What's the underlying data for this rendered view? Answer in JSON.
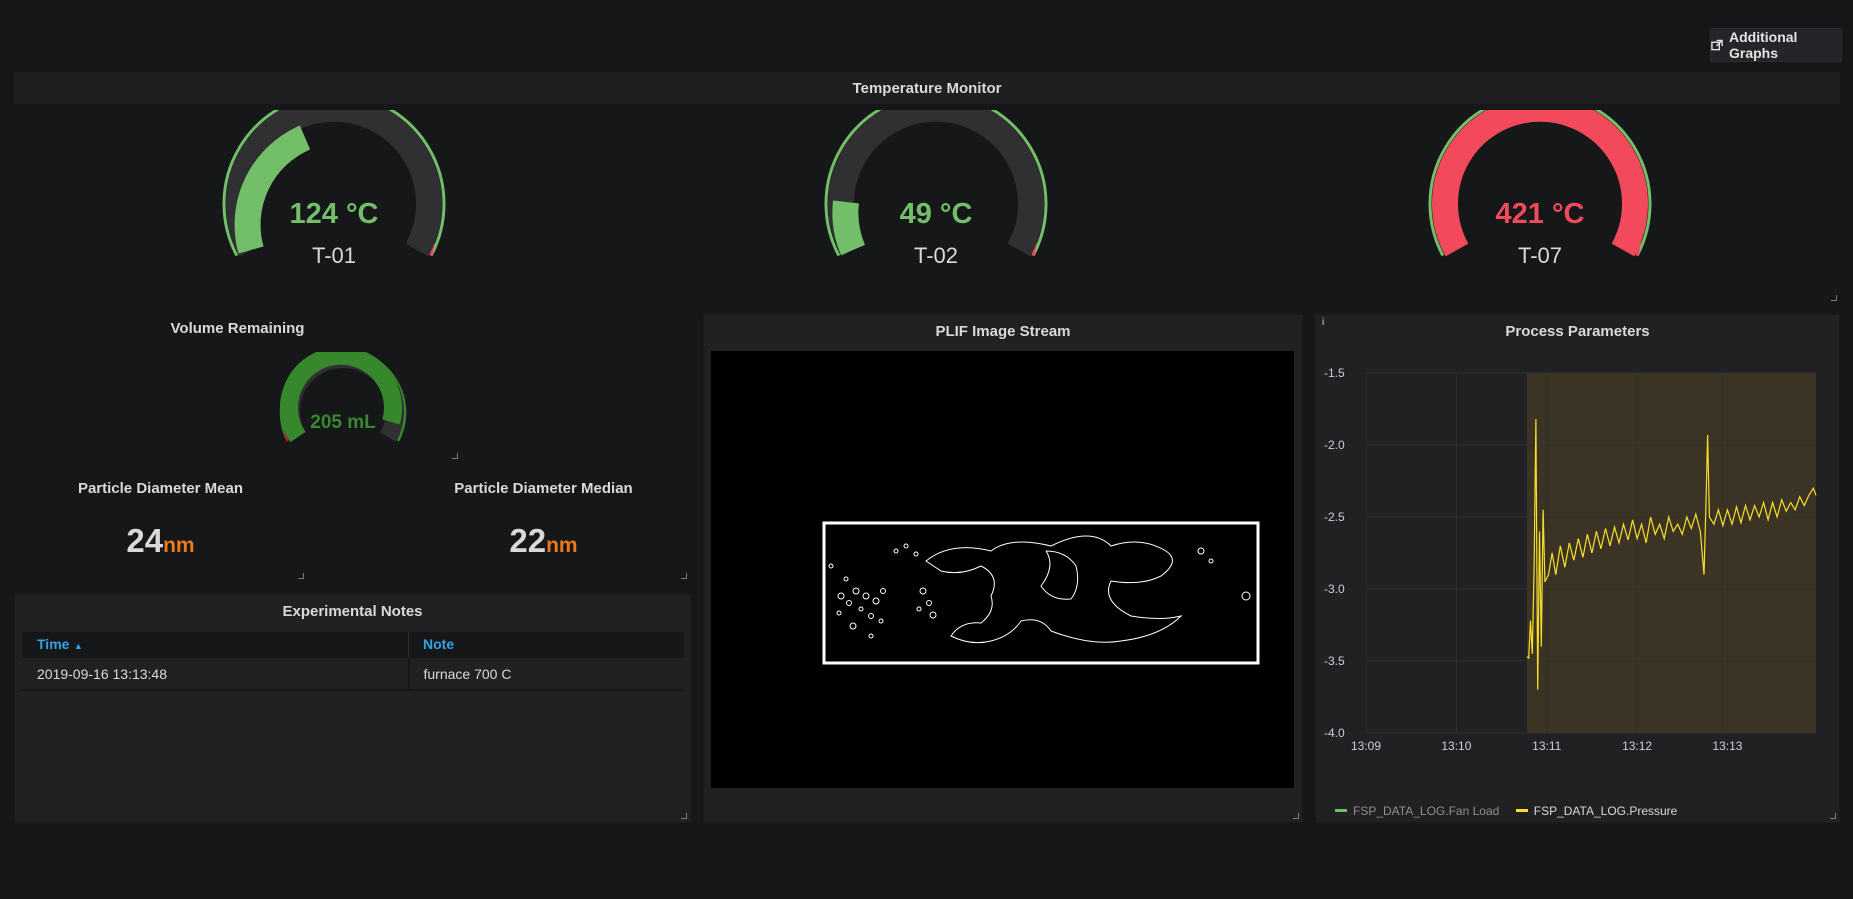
{
  "toolbar": {
    "additional_graphs_label": "Additional Graphs"
  },
  "temperature_monitor": {
    "title": "Temperature Monitor",
    "gauges": [
      {
        "name": "T-01",
        "value_text": "124 °C",
        "value": 124,
        "status_color": "#73bf69"
      },
      {
        "name": "T-02",
        "value_text": "49 °C",
        "value": 49,
        "status_color": "#73bf69"
      },
      {
        "name": "T-07",
        "value_text": "421 °C",
        "value": 421,
        "status_color": "#f2495c"
      }
    ]
  },
  "volume": {
    "title": "Volume Remaining",
    "value_text": "205 mL",
    "value": 205,
    "status_color": "#37872d"
  },
  "particle_mean": {
    "title": "Particle Diameter Mean",
    "value": "24",
    "unit": "nm"
  },
  "particle_median": {
    "title": "Particle Diameter Median",
    "value": "22",
    "unit": "nm"
  },
  "notes": {
    "title": "Experimental Notes",
    "columns": [
      "Time",
      "Note"
    ],
    "sort_indicator": "▲",
    "rows": [
      [
        "2019-09-16 13:13:48",
        "furnace 700 C"
      ]
    ]
  },
  "plif": {
    "title": "PLIF Image Stream"
  },
  "process": {
    "title": "Process Parameters",
    "info_icon": "i",
    "legend": [
      {
        "name": "FSP_DATA_LOG.Fan Load",
        "color": "#73bf69"
      },
      {
        "name": "FSP_DATA_LOG.Pressure",
        "color": "#fade2a"
      }
    ]
  },
  "chart_data": {
    "type": "line",
    "title": "Process Parameters",
    "x_ticks": [
      "13:09",
      "13:10",
      "13:11",
      "13:12",
      "13:13"
    ],
    "y_ticks": [
      "-1.5",
      "-2.0",
      "-2.5",
      "-3.0",
      "-3.5",
      "-4.0"
    ],
    "ylim": [
      -4.0,
      -1.5
    ],
    "xlim_minutes": [
      9.0,
      13.98
    ],
    "shaded_region_minutes": [
      10.78,
      13.98
    ],
    "series": [
      {
        "name": "FSP_DATA_LOG.Pressure",
        "color": "#fade2a",
        "points_minutes": [
          [
            10.78,
            -3.47
          ],
          [
            10.8,
            -3.48
          ],
          [
            10.82,
            -3.22
          ],
          [
            10.84,
            -3.45
          ],
          [
            10.86,
            -2.85
          ],
          [
            10.88,
            -1.82
          ],
          [
            10.9,
            -3.7
          ],
          [
            10.92,
            -2.6
          ],
          [
            10.94,
            -3.4
          ],
          [
            10.96,
            -2.45
          ],
          [
            10.98,
            -2.95
          ],
          [
            11.02,
            -2.9
          ],
          [
            11.06,
            -2.75
          ],
          [
            11.1,
            -2.9
          ],
          [
            11.15,
            -2.7
          ],
          [
            11.2,
            -2.85
          ],
          [
            11.25,
            -2.68
          ],
          [
            11.3,
            -2.8
          ],
          [
            11.35,
            -2.65
          ],
          [
            11.4,
            -2.78
          ],
          [
            11.45,
            -2.62
          ],
          [
            11.5,
            -2.75
          ],
          [
            11.55,
            -2.6
          ],
          [
            11.6,
            -2.72
          ],
          [
            11.65,
            -2.58
          ],
          [
            11.7,
            -2.7
          ],
          [
            11.75,
            -2.57
          ],
          [
            11.8,
            -2.68
          ],
          [
            11.85,
            -2.55
          ],
          [
            11.9,
            -2.66
          ],
          [
            11.95,
            -2.52
          ],
          [
            12.0,
            -2.65
          ],
          [
            12.05,
            -2.55
          ],
          [
            12.1,
            -2.68
          ],
          [
            12.15,
            -2.5
          ],
          [
            12.2,
            -2.62
          ],
          [
            12.25,
            -2.55
          ],
          [
            12.3,
            -2.65
          ],
          [
            12.35,
            -2.5
          ],
          [
            12.4,
            -2.6
          ],
          [
            12.45,
            -2.55
          ],
          [
            12.5,
            -2.62
          ],
          [
            12.55,
            -2.5
          ],
          [
            12.6,
            -2.58
          ],
          [
            12.65,
            -2.48
          ],
          [
            12.7,
            -2.6
          ],
          [
            12.74,
            -2.9
          ],
          [
            12.76,
            -2.45
          ],
          [
            12.78,
            -1.93
          ],
          [
            12.8,
            -2.5
          ],
          [
            12.85,
            -2.55
          ],
          [
            12.9,
            -2.45
          ],
          [
            12.95,
            -2.56
          ],
          [
            13.0,
            -2.45
          ],
          [
            13.05,
            -2.55
          ],
          [
            13.1,
            -2.43
          ],
          [
            13.15,
            -2.54
          ],
          [
            13.2,
            -2.42
          ],
          [
            13.25,
            -2.52
          ],
          [
            13.3,
            -2.42
          ],
          [
            13.35,
            -2.5
          ],
          [
            13.4,
            -2.4
          ],
          [
            13.45,
            -2.52
          ],
          [
            13.5,
            -2.4
          ],
          [
            13.55,
            -2.5
          ],
          [
            13.6,
            -2.38
          ],
          [
            13.65,
            -2.46
          ],
          [
            13.7,
            -2.4
          ],
          [
            13.75,
            -2.45
          ],
          [
            13.8,
            -2.36
          ],
          [
            13.85,
            -2.42
          ],
          [
            13.9,
            -2.35
          ],
          [
            13.95,
            -2.3
          ],
          [
            13.98,
            -2.35
          ]
        ]
      }
    ]
  }
}
